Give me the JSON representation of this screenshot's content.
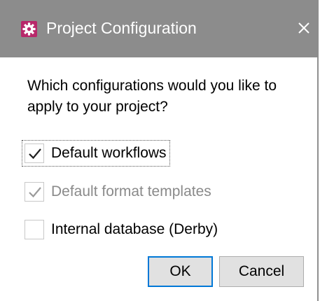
{
  "window": {
    "title": "Project Configuration",
    "icon": "gear-icon",
    "close_glyph": "✕"
  },
  "question": "Which configurations would you like to apply to your project?",
  "options": [
    {
      "label": "Default workflows",
      "checked": true,
      "enabled": true,
      "focused": true
    },
    {
      "label": "Default format templates",
      "checked": true,
      "enabled": false
    },
    {
      "label": "Internal database (Derby)",
      "checked": false,
      "enabled": true
    }
  ],
  "buttons": {
    "ok_label": "OK",
    "cancel_label": "Cancel"
  },
  "colors": {
    "titlebar": "#8c8c8c",
    "icon_accent": "#b8286a",
    "focus_border": "#0078d7",
    "disabled_text": "#8a8a8a"
  }
}
